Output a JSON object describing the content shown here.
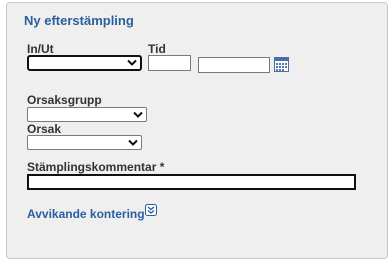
{
  "form": {
    "title": "Ny efterstämpling",
    "in_ut": {
      "label": "In/Ut",
      "selected": ""
    },
    "tid": {
      "label": "Tid",
      "time_value": "",
      "date_value": ""
    },
    "orsaksgrupp": {
      "label": "Orsaksgrupp",
      "selected": ""
    },
    "orsak": {
      "label": "Orsak",
      "selected": ""
    },
    "kommentar": {
      "label": "Stämplingskommentar *",
      "value": ""
    },
    "avvikande_kontering": {
      "label": "Avvikande kontering"
    }
  },
  "icons": {
    "calendar": "calendar-icon",
    "expand": "double-chevron-down-icon",
    "dropdown": "chevron-down-icon"
  },
  "colors": {
    "accent": "#2a5f9e",
    "panel_bg": "#efefef"
  }
}
